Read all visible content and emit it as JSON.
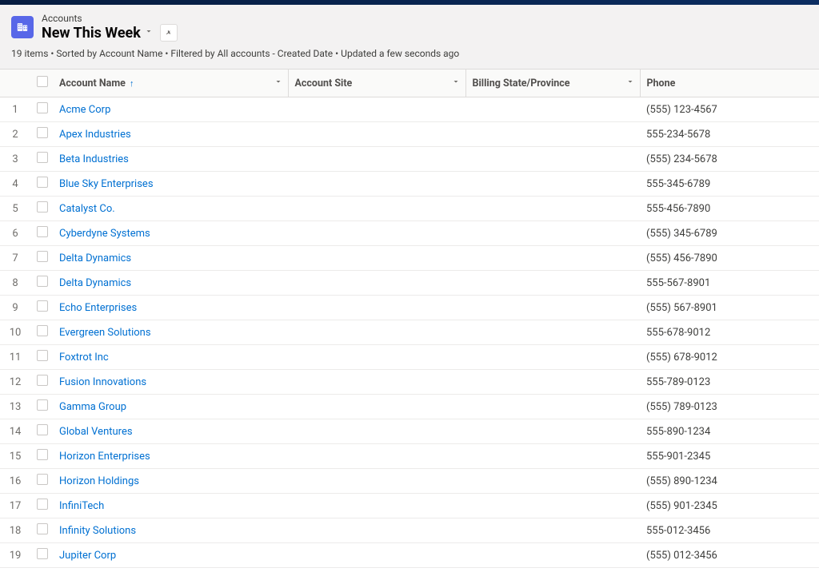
{
  "header": {
    "object_label": "Accounts",
    "view_name": "New This Week",
    "meta": "19 items • Sorted by Account Name • Filtered by All accounts - Created Date • Updated a few seconds ago"
  },
  "columns": {
    "account_name": "Account Name",
    "account_site": "Account Site",
    "billing_state": "Billing State/Province",
    "phone": "Phone"
  },
  "rows": [
    {
      "num": "1",
      "name": "Acme Corp",
      "site": "",
      "state": "",
      "phone": "(555) 123-4567"
    },
    {
      "num": "2",
      "name": "Apex Industries",
      "site": "",
      "state": "",
      "phone": "555-234-5678"
    },
    {
      "num": "3",
      "name": "Beta Industries",
      "site": "",
      "state": "",
      "phone": "(555) 234-5678"
    },
    {
      "num": "4",
      "name": "Blue Sky Enterprises",
      "site": "",
      "state": "",
      "phone": "555-345-6789"
    },
    {
      "num": "5",
      "name": "Catalyst Co.",
      "site": "",
      "state": "",
      "phone": "555-456-7890"
    },
    {
      "num": "6",
      "name": "Cyberdyne Systems",
      "site": "",
      "state": "",
      "phone": "(555) 345-6789"
    },
    {
      "num": "7",
      "name": "Delta Dynamics",
      "site": "",
      "state": "",
      "phone": "(555) 456-7890"
    },
    {
      "num": "8",
      "name": "Delta Dynamics",
      "site": "",
      "state": "",
      "phone": "555-567-8901"
    },
    {
      "num": "9",
      "name": "Echo Enterprises",
      "site": "",
      "state": "",
      "phone": "(555) 567-8901"
    },
    {
      "num": "10",
      "name": "Evergreen Solutions",
      "site": "",
      "state": "",
      "phone": "555-678-9012"
    },
    {
      "num": "11",
      "name": "Foxtrot Inc",
      "site": "",
      "state": "",
      "phone": "(555) 678-9012"
    },
    {
      "num": "12",
      "name": "Fusion Innovations",
      "site": "",
      "state": "",
      "phone": "555-789-0123"
    },
    {
      "num": "13",
      "name": "Gamma Group",
      "site": "",
      "state": "",
      "phone": "(555) 789-0123"
    },
    {
      "num": "14",
      "name": "Global Ventures",
      "site": "",
      "state": "",
      "phone": "555-890-1234"
    },
    {
      "num": "15",
      "name": "Horizon Enterprises",
      "site": "",
      "state": "",
      "phone": "555-901-2345"
    },
    {
      "num": "16",
      "name": "Horizon Holdings",
      "site": "",
      "state": "",
      "phone": "(555) 890-1234"
    },
    {
      "num": "17",
      "name": "InfiniTech",
      "site": "",
      "state": "",
      "phone": "(555) 901-2345"
    },
    {
      "num": "18",
      "name": "Infinity Solutions",
      "site": "",
      "state": "",
      "phone": "555-012-3456"
    },
    {
      "num": "19",
      "name": "Jupiter Corp",
      "site": "",
      "state": "",
      "phone": "(555) 012-3456"
    }
  ]
}
